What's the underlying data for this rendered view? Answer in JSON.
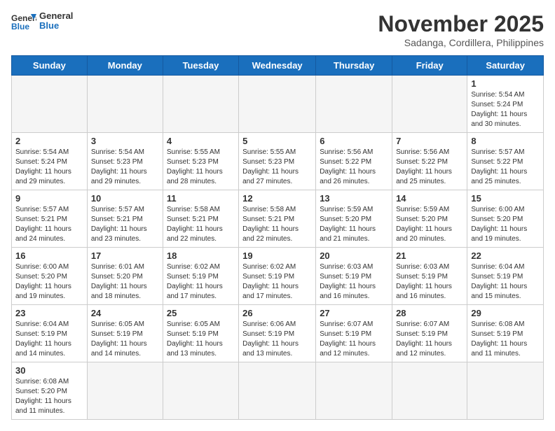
{
  "header": {
    "logo_general": "General",
    "logo_blue": "Blue",
    "month_title": "November 2025",
    "location": "Sadanga, Cordillera, Philippines"
  },
  "weekdays": [
    "Sunday",
    "Monday",
    "Tuesday",
    "Wednesday",
    "Thursday",
    "Friday",
    "Saturday"
  ],
  "days": [
    {
      "num": "",
      "info": ""
    },
    {
      "num": "",
      "info": ""
    },
    {
      "num": "",
      "info": ""
    },
    {
      "num": "",
      "info": ""
    },
    {
      "num": "",
      "info": ""
    },
    {
      "num": "",
      "info": ""
    },
    {
      "num": "1",
      "info": "Sunrise: 5:54 AM\nSunset: 5:24 PM\nDaylight: 11 hours\nand 30 minutes."
    },
    {
      "num": "2",
      "info": "Sunrise: 5:54 AM\nSunset: 5:24 PM\nDaylight: 11 hours\nand 29 minutes."
    },
    {
      "num": "3",
      "info": "Sunrise: 5:54 AM\nSunset: 5:23 PM\nDaylight: 11 hours\nand 29 minutes."
    },
    {
      "num": "4",
      "info": "Sunrise: 5:55 AM\nSunset: 5:23 PM\nDaylight: 11 hours\nand 28 minutes."
    },
    {
      "num": "5",
      "info": "Sunrise: 5:55 AM\nSunset: 5:23 PM\nDaylight: 11 hours\nand 27 minutes."
    },
    {
      "num": "6",
      "info": "Sunrise: 5:56 AM\nSunset: 5:22 PM\nDaylight: 11 hours\nand 26 minutes."
    },
    {
      "num": "7",
      "info": "Sunrise: 5:56 AM\nSunset: 5:22 PM\nDaylight: 11 hours\nand 25 minutes."
    },
    {
      "num": "8",
      "info": "Sunrise: 5:57 AM\nSunset: 5:22 PM\nDaylight: 11 hours\nand 25 minutes."
    },
    {
      "num": "9",
      "info": "Sunrise: 5:57 AM\nSunset: 5:21 PM\nDaylight: 11 hours\nand 24 minutes."
    },
    {
      "num": "10",
      "info": "Sunrise: 5:57 AM\nSunset: 5:21 PM\nDaylight: 11 hours\nand 23 minutes."
    },
    {
      "num": "11",
      "info": "Sunrise: 5:58 AM\nSunset: 5:21 PM\nDaylight: 11 hours\nand 22 minutes."
    },
    {
      "num": "12",
      "info": "Sunrise: 5:58 AM\nSunset: 5:21 PM\nDaylight: 11 hours\nand 22 minutes."
    },
    {
      "num": "13",
      "info": "Sunrise: 5:59 AM\nSunset: 5:20 PM\nDaylight: 11 hours\nand 21 minutes."
    },
    {
      "num": "14",
      "info": "Sunrise: 5:59 AM\nSunset: 5:20 PM\nDaylight: 11 hours\nand 20 minutes."
    },
    {
      "num": "15",
      "info": "Sunrise: 6:00 AM\nSunset: 5:20 PM\nDaylight: 11 hours\nand 19 minutes."
    },
    {
      "num": "16",
      "info": "Sunrise: 6:00 AM\nSunset: 5:20 PM\nDaylight: 11 hours\nand 19 minutes."
    },
    {
      "num": "17",
      "info": "Sunrise: 6:01 AM\nSunset: 5:20 PM\nDaylight: 11 hours\nand 18 minutes."
    },
    {
      "num": "18",
      "info": "Sunrise: 6:02 AM\nSunset: 5:19 PM\nDaylight: 11 hours\nand 17 minutes."
    },
    {
      "num": "19",
      "info": "Sunrise: 6:02 AM\nSunset: 5:19 PM\nDaylight: 11 hours\nand 17 minutes."
    },
    {
      "num": "20",
      "info": "Sunrise: 6:03 AM\nSunset: 5:19 PM\nDaylight: 11 hours\nand 16 minutes."
    },
    {
      "num": "21",
      "info": "Sunrise: 6:03 AM\nSunset: 5:19 PM\nDaylight: 11 hours\nand 16 minutes."
    },
    {
      "num": "22",
      "info": "Sunrise: 6:04 AM\nSunset: 5:19 PM\nDaylight: 11 hours\nand 15 minutes."
    },
    {
      "num": "23",
      "info": "Sunrise: 6:04 AM\nSunset: 5:19 PM\nDaylight: 11 hours\nand 14 minutes."
    },
    {
      "num": "24",
      "info": "Sunrise: 6:05 AM\nSunset: 5:19 PM\nDaylight: 11 hours\nand 14 minutes."
    },
    {
      "num": "25",
      "info": "Sunrise: 6:05 AM\nSunset: 5:19 PM\nDaylight: 11 hours\nand 13 minutes."
    },
    {
      "num": "26",
      "info": "Sunrise: 6:06 AM\nSunset: 5:19 PM\nDaylight: 11 hours\nand 13 minutes."
    },
    {
      "num": "27",
      "info": "Sunrise: 6:07 AM\nSunset: 5:19 PM\nDaylight: 11 hours\nand 12 minutes."
    },
    {
      "num": "28",
      "info": "Sunrise: 6:07 AM\nSunset: 5:19 PM\nDaylight: 11 hours\nand 12 minutes."
    },
    {
      "num": "29",
      "info": "Sunrise: 6:08 AM\nSunset: 5:19 PM\nDaylight: 11 hours\nand 11 minutes."
    },
    {
      "num": "30",
      "info": "Sunrise: 6:08 AM\nSunset: 5:20 PM\nDaylight: 11 hours\nand 11 minutes."
    },
    {
      "num": "",
      "info": ""
    },
    {
      "num": "",
      "info": ""
    },
    {
      "num": "",
      "info": ""
    },
    {
      "num": "",
      "info": ""
    },
    {
      "num": "",
      "info": ""
    },
    {
      "num": "",
      "info": ""
    }
  ]
}
